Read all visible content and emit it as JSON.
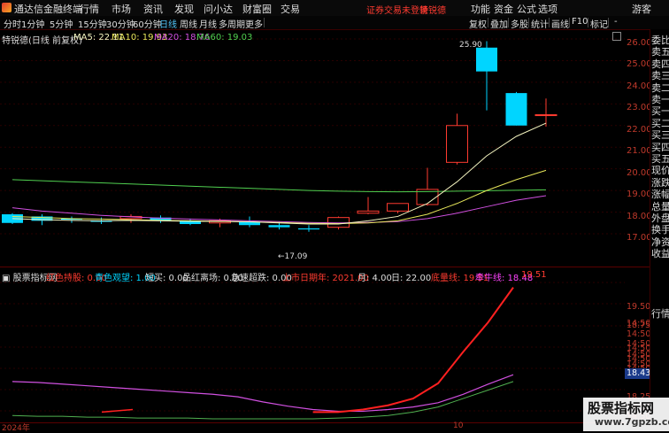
{
  "app": {
    "title": "通达信金融终端"
  },
  "menu": {
    "items": [
      "行情",
      "市场",
      "资讯",
      "发现",
      "问小达",
      "财富圈",
      "交易"
    ]
  },
  "status": {
    "login_warning": "证券交易未登录",
    "stock": "特锐德"
  },
  "menu_right": {
    "items": [
      "功能",
      "资金",
      "公式",
      "选项"
    ],
    "guest": "游客"
  },
  "toolbar": {
    "periods": [
      "分时",
      "1分钟",
      "5分钟",
      "15分钟",
      "30分钟",
      "60分钟",
      "日线",
      "周线",
      "月线",
      "多周期",
      "更多"
    ],
    "active_period": "日线",
    "right_tools": [
      "复权",
      "叠加",
      "多股",
      "统计",
      "画线",
      "F10",
      "标记",
      "-"
    ]
  },
  "main_header": {
    "label": "特锐德(日线 前复权)",
    "ma5": "MA5: 22.11",
    "ma10": "MA10: 19.93",
    "ma20": "MA20: 18.76",
    "ma60": "MA60: 19.03"
  },
  "price_axis": [
    "26.00",
    "25.00",
    "24.00",
    "23.00",
    "22.00",
    "21.00",
    "20.00",
    "19.00",
    "18.00",
    "17.00"
  ],
  "annotations": {
    "high": "25.90",
    "low": "17.09"
  },
  "sub_header": {
    "name": "股票指标网",
    "items": [
      {
        "label": "红色持股: 0.00",
        "color": "#ff3b30"
      },
      {
        "label": "青色观望: 1.00",
        "color": "#00d5ff"
      },
      {
        "label": "短买: 0.00",
        "color": "#dddddd"
      },
      {
        "label": "品红离场: 0.00",
        "color": "#dddddd"
      },
      {
        "label": "急速超跌: 0.00",
        "color": "#dddddd"
      },
      {
        "label": "上市日期年: 2021.00",
        "color": "#ff3b30"
      },
      {
        "label": "月: 4.00",
        "color": "#dddddd"
      },
      {
        "label": "日: 22.00",
        "color": "#dddddd"
      },
      {
        "label": "底量线: 19.51",
        "color": "#ff3b30"
      },
      {
        "label": "牵牛线: 18.48",
        "color": "#ff44ff"
      },
      {
        "label": "19.51",
        "color": "#ff3b30"
      }
    ]
  },
  "sub_axis": [
    "19.50",
    "14:50",
    "14:50",
    "14:50",
    "14:50",
    "14:50",
    "18.75",
    "14:50",
    "14:50",
    "14:50",
    "18.43",
    "18.25",
    "14:50",
    "14:50"
  ],
  "sub_price_box": "18.43",
  "right_panel": [
    "委比",
    "卖五",
    "卖四",
    "卖三",
    "卖二",
    "卖一",
    "买一",
    "买二",
    "买三",
    "买四",
    "买五",
    "现价",
    "涨跌",
    "涨幅",
    "总量",
    "外盘",
    "换手",
    "净资",
    "收益",
    "行情"
  ],
  "dates": {
    "left": "2024年",
    "mark": "10"
  },
  "watermark": {
    "line1": "股票指标网",
    "line2": "www.7gpzb.com"
  },
  "colors": {
    "up": "#ff3b30",
    "down": "#00d5ff",
    "ma5": "#f4f4c0",
    "ma10": "#e6e65a",
    "ma20": "#d050e0",
    "ma60": "#50d050"
  },
  "chart_data": {
    "type": "candlestick",
    "ylim": [
      16.6,
      26.6
    ],
    "candles": [
      {
        "o": 17.9,
        "h": 17.95,
        "l": 17.45,
        "c": 17.5
      },
      {
        "o": 17.8,
        "h": 17.9,
        "l": 17.4,
        "c": 17.6
      },
      {
        "o": 17.7,
        "h": 17.8,
        "l": 17.5,
        "c": 17.65
      },
      {
        "o": 17.6,
        "h": 17.75,
        "l": 17.45,
        "c": 17.55
      },
      {
        "o": 17.7,
        "h": 17.9,
        "l": 17.5,
        "c": 17.8
      },
      {
        "o": 17.75,
        "h": 17.85,
        "l": 17.5,
        "c": 17.6
      },
      {
        "o": 17.6,
        "h": 17.7,
        "l": 17.4,
        "c": 17.45
      },
      {
        "o": 17.5,
        "h": 17.7,
        "l": 17.3,
        "c": 17.6
      },
      {
        "o": 17.55,
        "h": 17.8,
        "l": 17.3,
        "c": 17.4
      },
      {
        "o": 17.4,
        "h": 17.55,
        "l": 17.2,
        "c": 17.3
      },
      {
        "o": 17.25,
        "h": 17.4,
        "l": 17.09,
        "c": 17.2
      },
      {
        "o": 17.3,
        "h": 17.8,
        "l": 17.2,
        "c": 17.75
      },
      {
        "o": 17.95,
        "h": 18.7,
        "l": 17.9,
        "c": 18.05
      },
      {
        "o": 18.05,
        "h": 18.4,
        "l": 17.95,
        "c": 18.4
      },
      {
        "o": 18.35,
        "h": 20.05,
        "l": 18.3,
        "c": 19.05
      },
      {
        "o": 20.3,
        "h": 22.55,
        "l": 20.2,
        "c": 22.0
      },
      {
        "o": 25.6,
        "h": 25.9,
        "l": 22.7,
        "c": 24.5
      },
      {
        "o": 23.5,
        "h": 23.55,
        "l": 22.0,
        "c": 22.0
      },
      {
        "o": 22.5,
        "h": 23.25,
        "l": 21.95,
        "c": 22.5
      }
    ],
    "ma5": [
      17.7,
      17.65,
      17.62,
      17.6,
      17.62,
      17.6,
      17.58,
      17.57,
      17.55,
      17.5,
      17.45,
      17.45,
      17.6,
      17.8,
      18.4,
      19.4,
      20.6,
      21.5,
      22.11
    ],
    "ma10": [
      17.8,
      17.75,
      17.7,
      17.68,
      17.65,
      17.62,
      17.6,
      17.58,
      17.55,
      17.52,
      17.48,
      17.47,
      17.5,
      17.6,
      17.9,
      18.4,
      19.0,
      19.5,
      19.93
    ],
    "ma20": [
      18.2,
      18.05,
      17.95,
      17.85,
      17.78,
      17.72,
      17.68,
      17.64,
      17.6,
      17.56,
      17.52,
      17.5,
      17.52,
      17.56,
      17.7,
      17.95,
      18.25,
      18.55,
      18.76
    ],
    "ma60": [
      19.5,
      19.45,
      19.4,
      19.35,
      19.3,
      19.25,
      19.2,
      19.15,
      19.1,
      19.05,
      19.0,
      18.97,
      18.95,
      18.94,
      18.95,
      18.97,
      18.99,
      19.01,
      19.03
    ],
    "indicator": {
      "ylim": [
        17.95,
        19.6
      ],
      "floor_line": [
        18.3,
        18.28,
        18.26,
        18.24,
        18.22,
        18.2,
        18.18,
        18.16,
        18.14,
        18.12,
        18.08,
        18.05,
        18.04,
        18.04,
        18.07,
        18.12,
        18.2,
        18.38,
        18.75,
        19.1,
        19.51
      ],
      "bull_line": [
        18.4,
        18.39,
        18.37,
        18.35,
        18.33,
        18.31,
        18.29,
        18.27,
        18.25,
        18.22,
        18.16,
        18.11,
        18.07,
        18.05,
        18.05,
        18.07,
        18.1,
        18.15,
        18.25,
        18.37,
        18.48
      ],
      "green_line": [
        18.0,
        17.99,
        17.99,
        17.98,
        17.98,
        17.97,
        17.97,
        17.97,
        17.96,
        17.96,
        17.96,
        17.96,
        17.96,
        17.97,
        17.98,
        18.0,
        18.04,
        18.1,
        18.2,
        18.3,
        18.4
      ],
      "red_short": [
        18.04,
        18.07
      ]
    }
  }
}
